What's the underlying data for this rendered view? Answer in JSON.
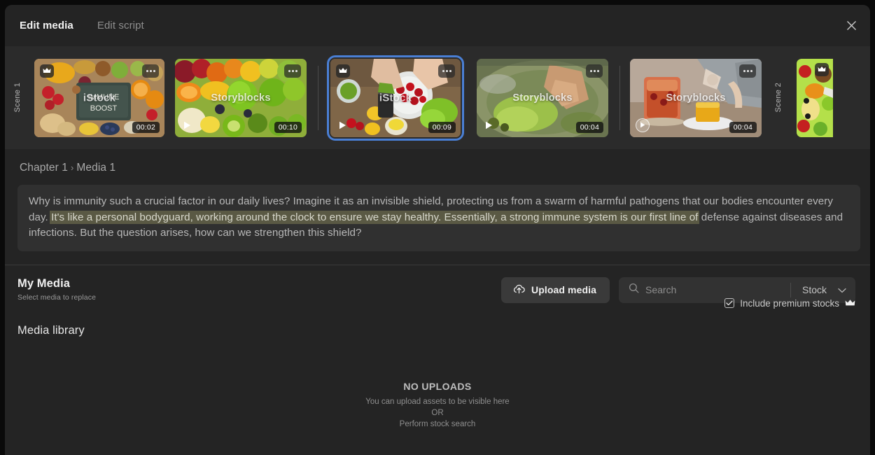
{
  "window": {
    "close_icon": "close-icon"
  },
  "tabs": [
    {
      "label": "Edit media",
      "active": true
    },
    {
      "label": "Edit script",
      "active": false
    }
  ],
  "strip": {
    "scene_1_label": "Scene 1",
    "scene_2_label": "Scene 2",
    "thumbnails": [
      {
        "watermark": "iStock",
        "duration": "00:02",
        "premium": true,
        "selected": false,
        "play": false,
        "play_circled": false,
        "menu": "more-options-icon"
      },
      {
        "watermark": "Storyblocks",
        "duration": "00:10",
        "premium": false,
        "selected": false,
        "play": true,
        "play_circled": false,
        "menu": "more-options-icon"
      },
      {
        "watermark": "iStock",
        "duration": "00:09",
        "premium": true,
        "selected": true,
        "play": true,
        "play_circled": false,
        "menu": "more-options-icon"
      },
      {
        "watermark": "Storyblocks",
        "duration": "00:04",
        "premium": false,
        "selected": false,
        "play": true,
        "play_circled": false,
        "menu": "more-options-icon"
      },
      {
        "watermark": "Storyblocks",
        "duration": "00:04",
        "premium": false,
        "selected": false,
        "play": true,
        "play_circled": true,
        "menu": "more-options-icon"
      }
    ]
  },
  "breadcrumb": {
    "chapter": "Chapter 1",
    "separator": "›",
    "media": "Media 1"
  },
  "script": {
    "part1": "Why is immunity such a crucial factor in our daily lives? Imagine it as an invisible shield, protecting us from a swarm of harmful pathogens that our bodies encounter every day. ",
    "highlight": "It's like a personal bodyguard, working around the clock to ensure we stay healthy. Essentially, a strong immune system is our first line of",
    "part2": " defense against diseases and infections. But the question arises, how can we strengthen this shield?"
  },
  "my_media": {
    "title": "My Media",
    "subtitle": "Select media to replace",
    "upload_label": "Upload media",
    "upload_icon": "cloud-upload-icon",
    "search_placeholder": "Search",
    "search_value": "",
    "search_icon": "search-icon",
    "stock_label": "Stock",
    "stock_chevron": "chevron-down-icon",
    "premium_label": "Include premium stocks",
    "premium_checked": true,
    "premium_icon": "crown-icon"
  },
  "library": {
    "title": "Media library",
    "empty_title": "NO UPLOADS",
    "empty_line1": "You can upload assets to be visible here",
    "empty_line2": "OR",
    "empty_line3": "Perform stock search"
  },
  "colors": {
    "accent": "#4a7fd4",
    "panel": "#242424",
    "strip": "#2b2b2b",
    "highlight": "#5a5944"
  }
}
